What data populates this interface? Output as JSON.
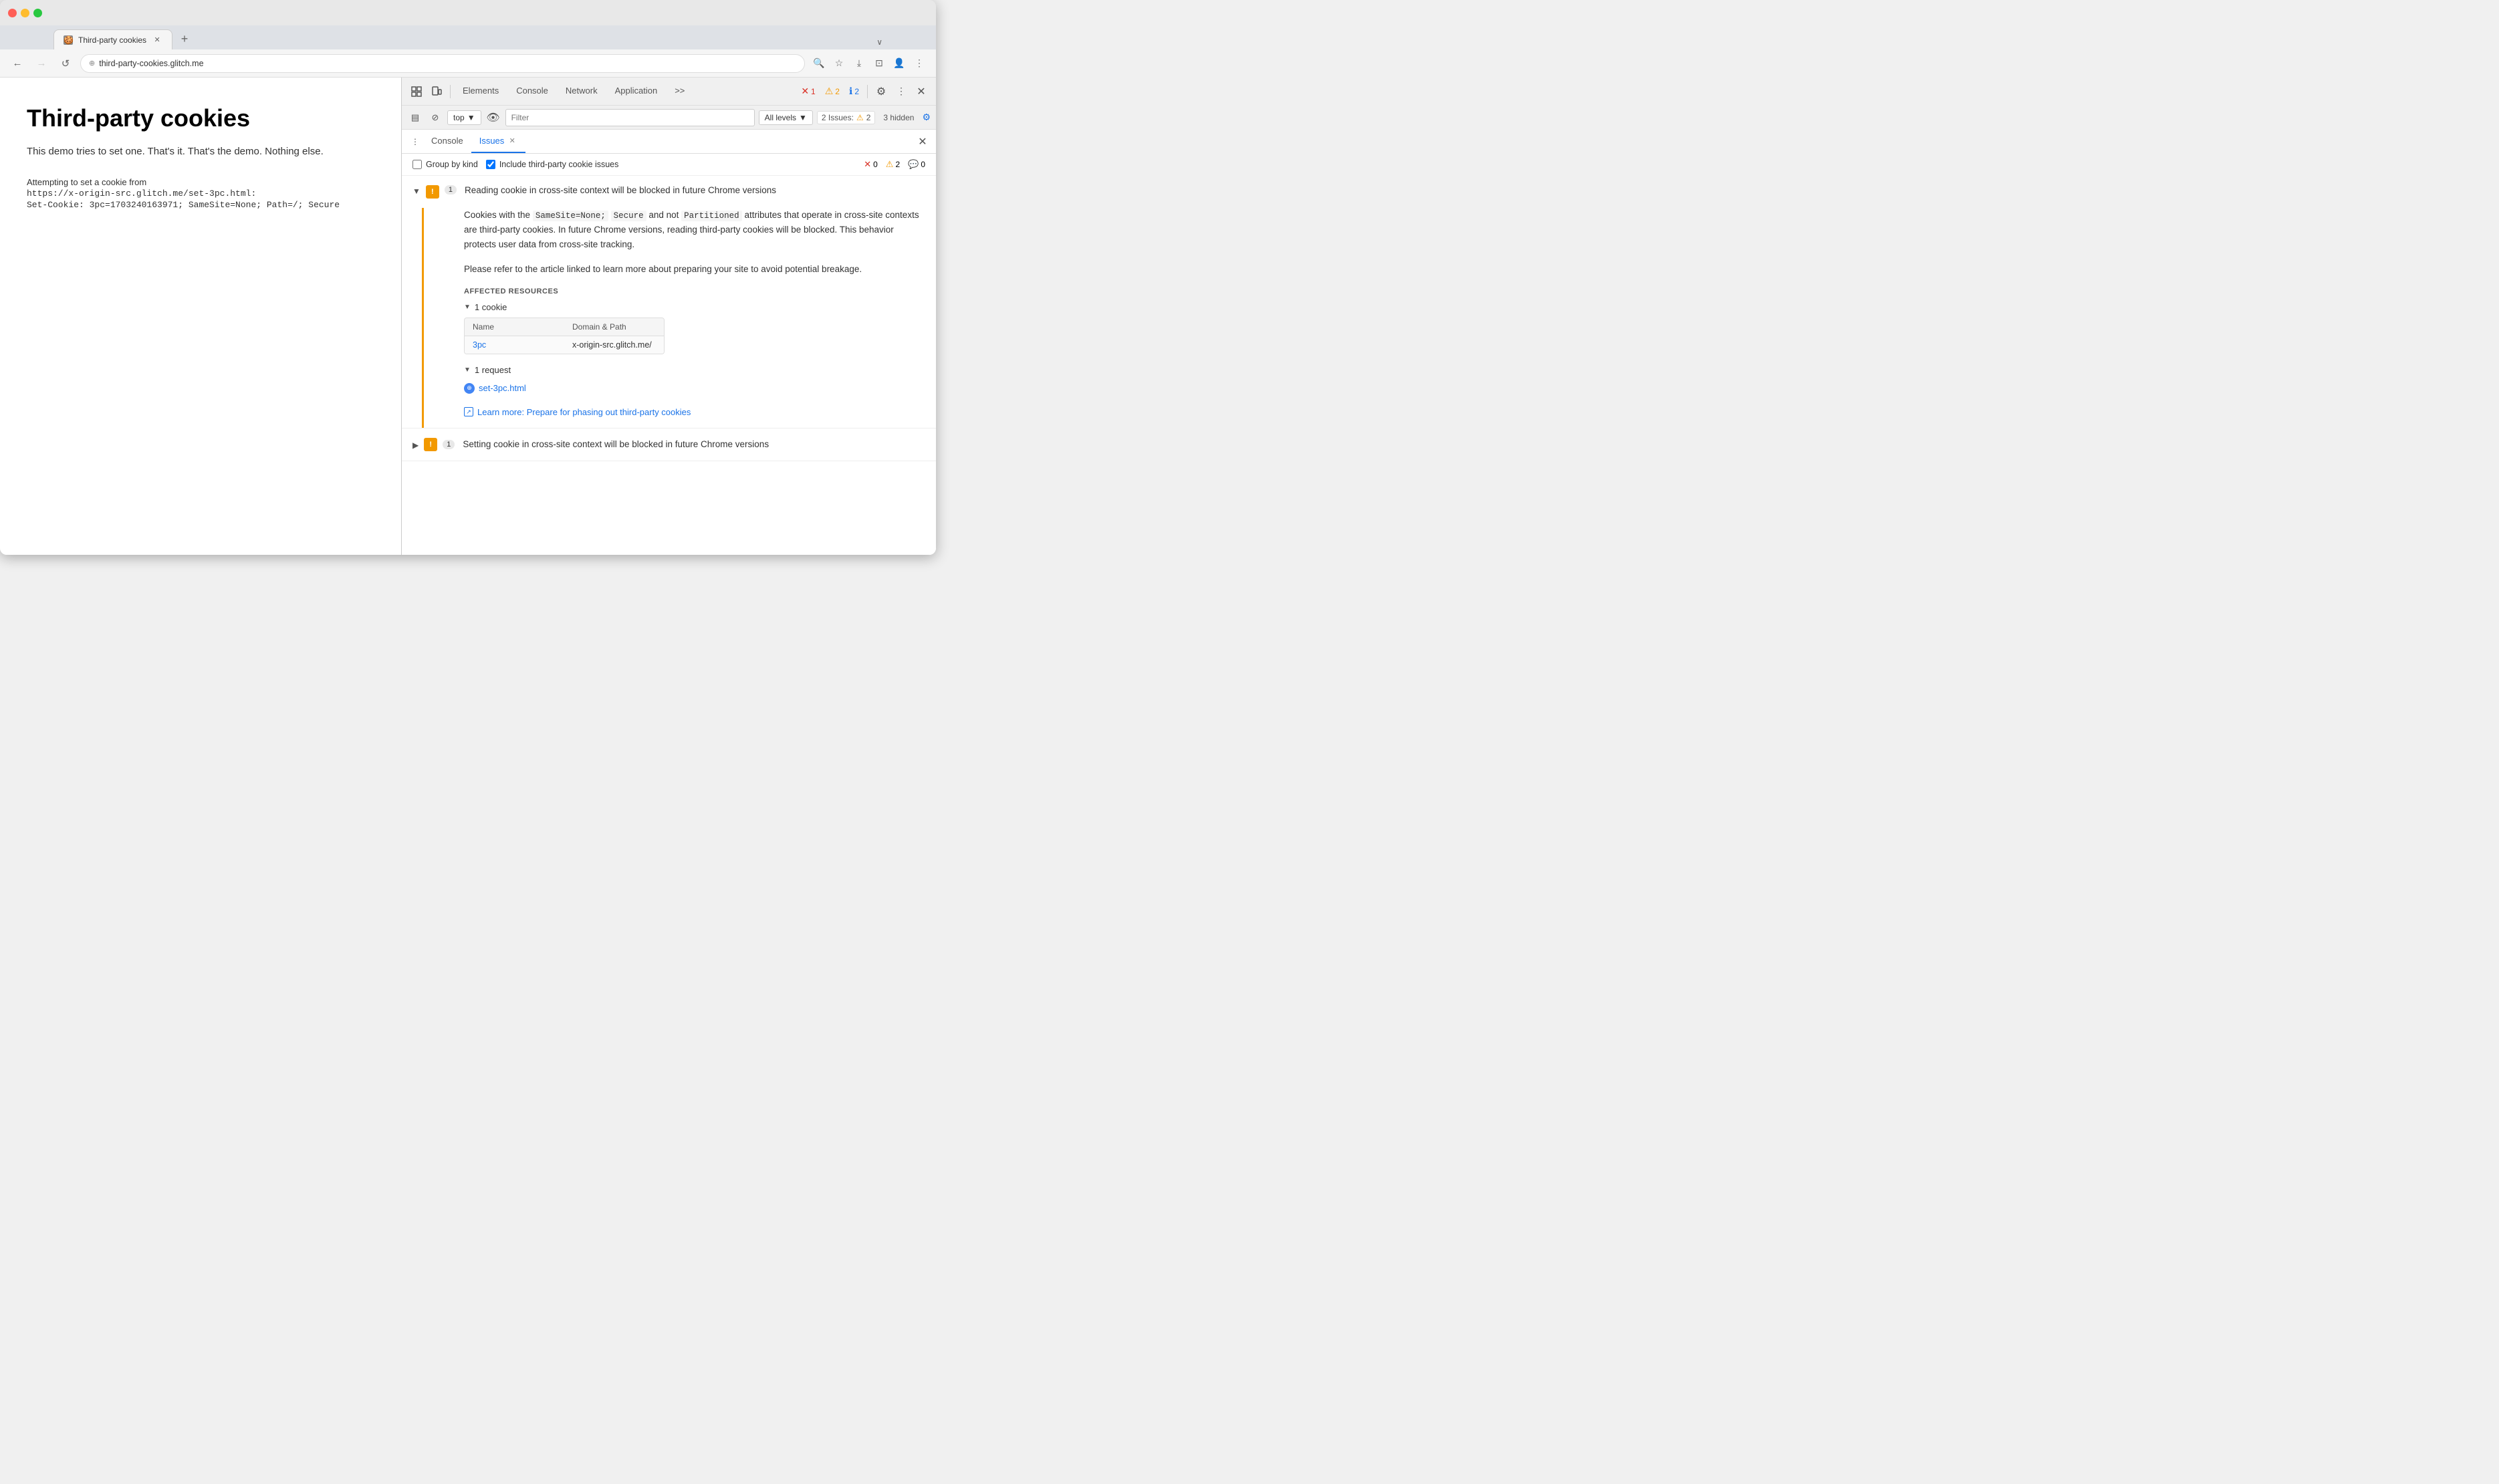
{
  "browser": {
    "tab_title": "Third-party cookies",
    "tab_favicon": "🍪",
    "url": "third-party-cookies.glitch.me",
    "url_icon": "↺"
  },
  "nav": {
    "back_label": "←",
    "forward_label": "→",
    "reload_label": "↺",
    "zoom_label": "⌖"
  },
  "page": {
    "title": "Third-party cookies",
    "description": "This demo tries to set one. That's it. That's the demo. Nothing else.",
    "log_intro": "Attempting to set a cookie from",
    "log_url": "https://x-origin-src.glitch.me/set-3pc.html:",
    "log_cookie": "Set-Cookie: 3pc=1703240163971; SameSite=None; Path=/; Secure"
  },
  "devtools": {
    "toolbar": {
      "inspect_icon": "⋮⋮",
      "device_icon": "📱",
      "tabs": [
        {
          "label": "Elements",
          "active": false
        },
        {
          "label": "Console",
          "active": false
        },
        {
          "label": "Network",
          "active": false
        },
        {
          "label": "Application",
          "active": false
        },
        {
          "label": ">>",
          "active": false
        }
      ],
      "error_count": "1",
      "warn_count": "2",
      "info_count": "2",
      "gear_icon": "⚙",
      "more_icon": "⋮",
      "close_icon": "✕"
    },
    "secondary_toolbar": {
      "sidebar_icon": "▤",
      "ban_icon": "⊘",
      "context": "top",
      "eye_icon": "👁",
      "filter_placeholder": "Filter",
      "levels_label": "All levels",
      "issues_label": "2 Issues:",
      "issues_warn_count": "2",
      "hidden_label": "3 hidden",
      "settings_icon": "⚙"
    },
    "panel_tabs": {
      "menu_icon": "⋮",
      "tabs": [
        {
          "label": "Console",
          "active": false,
          "closable": false
        },
        {
          "label": "Issues",
          "active": true,
          "closable": true
        }
      ],
      "close_icon": "✕"
    },
    "issues": {
      "group_by_kind_label": "Group by kind",
      "include_third_party_label": "Include third-party cookie issues",
      "include_third_party_checked": true,
      "error_count": "0",
      "warn_count": "2",
      "info_count": "0",
      "items": [
        {
          "expanded": true,
          "icon_type": "warn",
          "count": "1",
          "title": "Reading cookie in cross-site context will be blocked in future Chrome versions",
          "description_part1": "Cookies with the ",
          "code1": "SameSite=None;",
          "description_part2": " ",
          "code2": "Secure",
          "description_part3": " and not ",
          "code3": "Partitioned",
          "description_part4": " attributes that operate in cross-site contexts are third-party cookies. In future Chrome versions, reading third-party cookies will be blocked. This behavior protects user data from cross-site tracking.",
          "description_part5": "Please refer to the article linked to learn more about preparing your site to avoid potential breakage.",
          "affected_resources_label": "AFFECTED RESOURCES",
          "cookie_section_label": "1 cookie",
          "cookie_table_headers": [
            "Name",
            "Domain & Path"
          ],
          "cookies": [
            {
              "name": "3pc",
              "domain": "x-origin-src.glitch.me/"
            }
          ],
          "request_section_label": "1 request",
          "requests": [
            {
              "label": "set-3pc.html"
            }
          ],
          "learn_more_label": "Learn more: Prepare for phasing out third-party cookies",
          "learn_more_url": "#"
        },
        {
          "expanded": false,
          "icon_type": "warn",
          "count": "1",
          "title": "Setting cookie in cross-site context will be blocked in future Chrome versions"
        }
      ]
    }
  }
}
